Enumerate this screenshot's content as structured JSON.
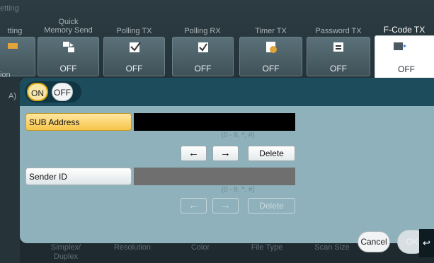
{
  "breadcrumb": "etting",
  "tabs": [
    {
      "label": "tting",
      "status": "",
      "icon": "partial-icon"
    },
    {
      "label": "Quick\nMemory Send",
      "status": "OFF",
      "icon": "quick-memory-send-icon"
    },
    {
      "label": "Polling TX",
      "status": "OFF",
      "icon": "polling-tx-icon"
    },
    {
      "label": "Polling RX",
      "status": "OFF",
      "icon": "polling-rx-icon"
    },
    {
      "label": "Timer TX",
      "status": "OFF",
      "icon": "timer-tx-icon"
    },
    {
      "label": "Password TX",
      "status": "OFF",
      "icon": "password-tx-icon"
    },
    {
      "label": "F-Code TX",
      "status": "OFF",
      "icon": "f-code-tx-icon"
    }
  ],
  "left_edge": {
    "item1": "ion",
    "item2": "A)"
  },
  "toggle": {
    "on": "ON",
    "off": "OFF"
  },
  "sub_address": {
    "label": "SUB Address",
    "value": "",
    "hint": "(0 - 9, *, #)"
  },
  "sender_id": {
    "label": "Sender ID",
    "value": "",
    "hint": "(0 - 9, *, #)"
  },
  "controls": {
    "left": "←",
    "right": "→",
    "delete": "Delete"
  },
  "bottom_tabs": [
    "Simplex/\nDuplex",
    "Resolution",
    "Color",
    "File Type",
    "Scan Size"
  ],
  "actions": {
    "cancel": "Cancel",
    "ok": "OK",
    "back": "↩"
  },
  "colors": {
    "panel": "#8eb1bb",
    "header": "#1d4d5c",
    "selected": "#f6c54a"
  }
}
